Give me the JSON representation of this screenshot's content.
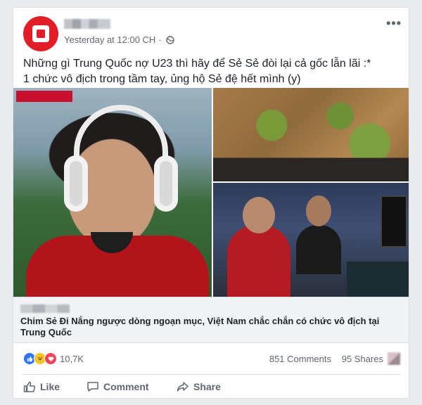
{
  "post": {
    "meta": {
      "time": "Yesterday at 12:00 CH",
      "separator": "·"
    },
    "text_line1": "Những gì Trung Quốc nợ U23 thì hãy để Sẻ Sẻ đòi lại cả gốc lẫn lãi :*",
    "text_line2": "1 chức vô địch trong tầm tay, ủng hộ Sẻ đệ hết mình (y)"
  },
  "link": {
    "title": "Chim Sẻ Đi Nắng ngược dòng ngoạn mục, Việt Nam chắc chắn có chức vô địch tại Trung Quốc"
  },
  "stats": {
    "reactions_count": "10,7K",
    "comments": "851 Comments",
    "shares": "95 Shares"
  },
  "actions": {
    "like": "Like",
    "comment": "Comment",
    "share": "Share"
  },
  "icons": {
    "more": "more-icon",
    "globe": "globe-icon",
    "like": "thumbs-up-icon",
    "comment": "comment-bubble-icon",
    "share": "share-arrow-icon"
  },
  "colors": {
    "page_bg": "#e9ebee",
    "text": "#1d2129",
    "muted": "#606770",
    "like_blue": "#2f74f6",
    "love_red": "#f2435a",
    "haha_yellow": "#f7c326"
  }
}
